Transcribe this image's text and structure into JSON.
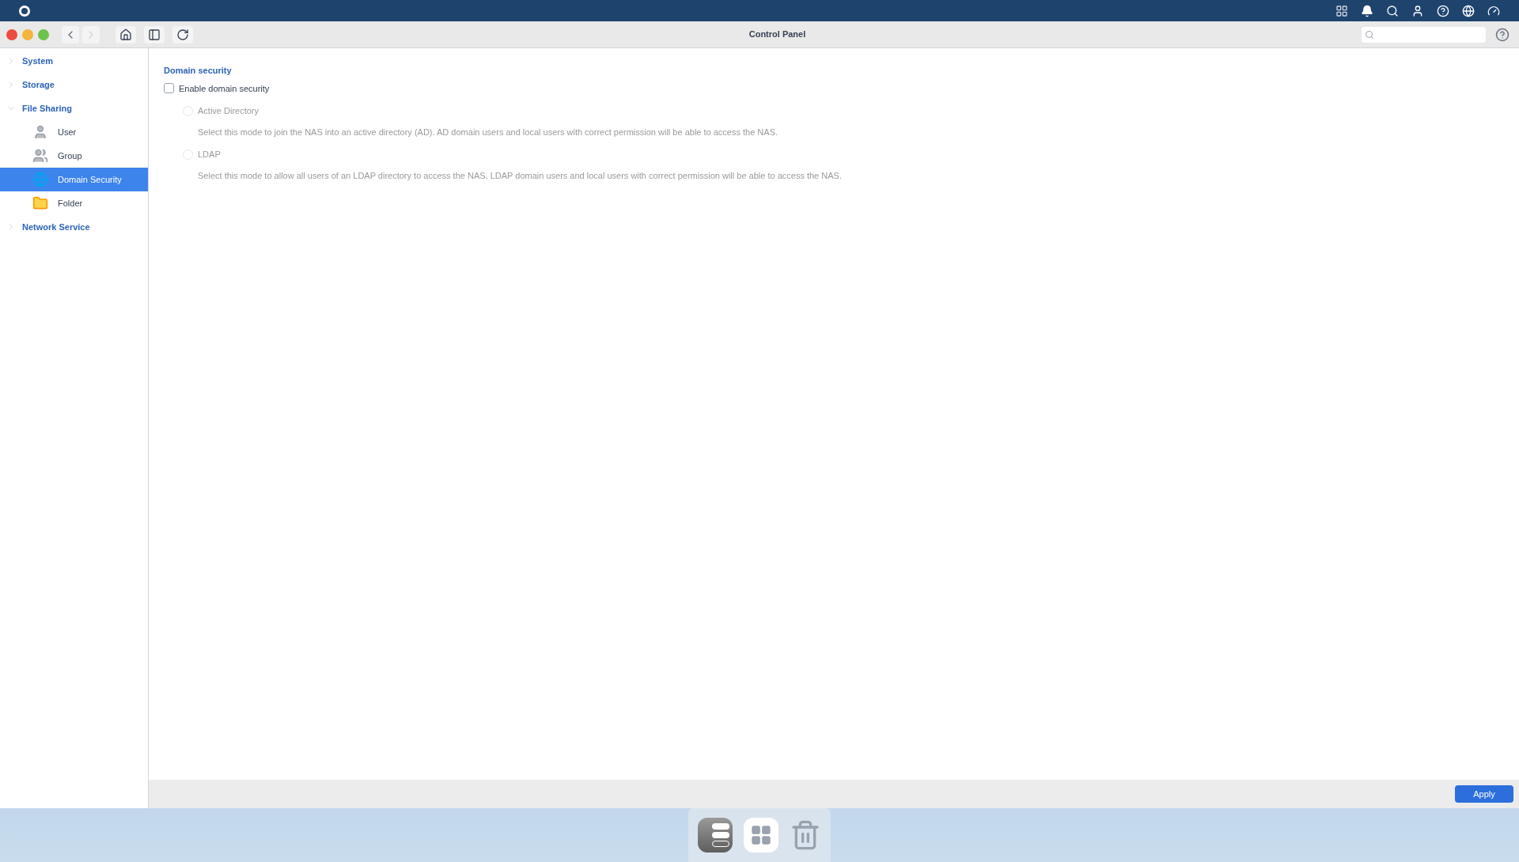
{
  "window": {
    "title": "Control Panel"
  },
  "sidebar": {
    "items": [
      {
        "label": "System",
        "expanded": false,
        "selected": false
      },
      {
        "label": "Storage",
        "expanded": false,
        "selected": false
      },
      {
        "label": "File Sharing",
        "expanded": true,
        "selected": false,
        "children": [
          {
            "label": "User",
            "selected": false
          },
          {
            "label": "Group",
            "selected": false
          },
          {
            "label": "Domain Security",
            "selected": true
          },
          {
            "label": "Folder",
            "selected": false
          }
        ]
      },
      {
        "label": "Network Service",
        "expanded": false,
        "selected": false
      }
    ]
  },
  "content": {
    "heading": "Domain security",
    "enable": {
      "label": "Enable domain security",
      "checked": false
    },
    "modes": [
      {
        "label": "Active Directory",
        "selected": false,
        "disabled": true,
        "description": "Select this mode to join the NAS into an active directory (AD). AD domain users and local users with correct permission will be able to access the NAS."
      },
      {
        "label": "LDAP",
        "selected": false,
        "disabled": true,
        "description": "Select this mode to allow all users of an LDAP directory to access the NAS. LDAP domain users and local users with correct permission will be able to access the NAS."
      }
    ]
  },
  "footer": {
    "button": "Apply"
  }
}
